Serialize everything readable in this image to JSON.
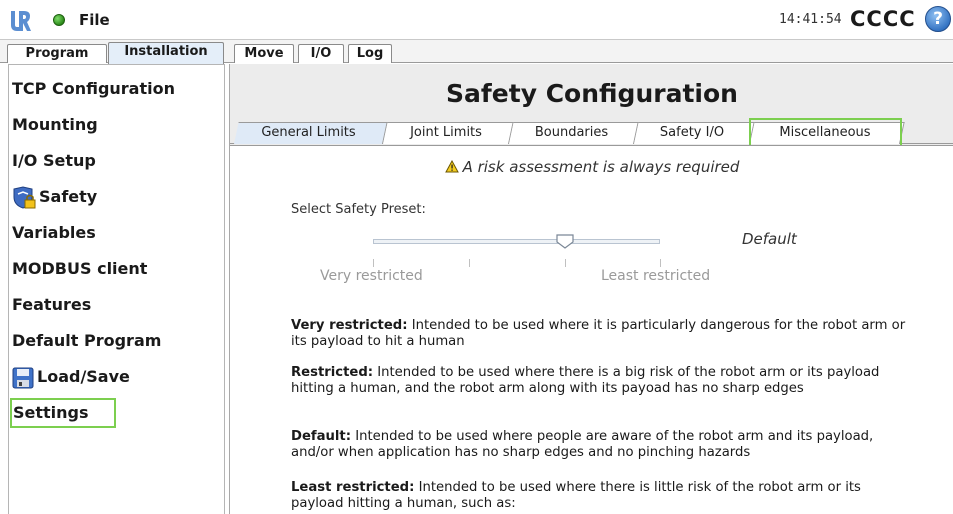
{
  "header": {
    "file_label": "File",
    "time": "14:41:54",
    "robot_name": "CCCC",
    "help_symbol": "?",
    "status_color": "#3aa51f"
  },
  "main_tabs": [
    {
      "label": "Program",
      "active": false
    },
    {
      "label": "Installation",
      "active": true
    },
    {
      "label": "Move",
      "active": false
    },
    {
      "label": "I/O",
      "active": false
    },
    {
      "label": "Log",
      "active": false
    }
  ],
  "sidebar": {
    "items": [
      {
        "label": "TCP Configuration",
        "icon": null
      },
      {
        "label": "Mounting",
        "icon": null
      },
      {
        "label": "I/O Setup",
        "icon": null
      },
      {
        "label": "Safety",
        "icon": "shield-lock-icon"
      },
      {
        "label": "Variables",
        "icon": null
      },
      {
        "label": "MODBUS client",
        "icon": null
      },
      {
        "label": "Features",
        "icon": null
      },
      {
        "label": "Default Program",
        "icon": null
      },
      {
        "label": "Load/Save",
        "icon": "floppy-disk-icon"
      },
      {
        "label": "Settings",
        "icon": null,
        "selected": true
      }
    ]
  },
  "safety": {
    "title": "Safety Configuration",
    "tabs": [
      {
        "label": "General Limits",
        "active": true
      },
      {
        "label": "Joint Limits",
        "active": false
      },
      {
        "label": "Boundaries",
        "active": false
      },
      {
        "label": "Safety I/O",
        "active": false
      },
      {
        "label": "Miscellaneous",
        "active": false
      }
    ],
    "warning": "A risk assessment is always required",
    "preset_label": "Select Safety Preset:",
    "preset_value": "Default",
    "preset_position": 0.67,
    "scale_left": "Very restricted",
    "scale_right": "Least restricted",
    "descriptions": [
      {
        "term": "Very restricted:",
        "text": " Intended to be used where it is particularly dangerous for the robot arm or its payload to hit a human"
      },
      {
        "term": "Restricted:",
        "text": " Intended to be used where there is a big risk of the robot arm or its payload hitting a human, and the robot arm along with its payoad has no sharp edges"
      },
      {
        "term": "Default:",
        "text": " Intended to be used where people are aware of the robot arm and its payload, and/or when application has no sharp edges and no pinching hazards"
      },
      {
        "term": "Least restricted:",
        "text": " Intended to be used where there is little risk of the robot arm or its payload hitting a human, such as:"
      }
    ]
  },
  "colors": {
    "highlight": "#7ccf4f",
    "active_tab": "#dfeaf7",
    "content_bg": "#ececec"
  }
}
